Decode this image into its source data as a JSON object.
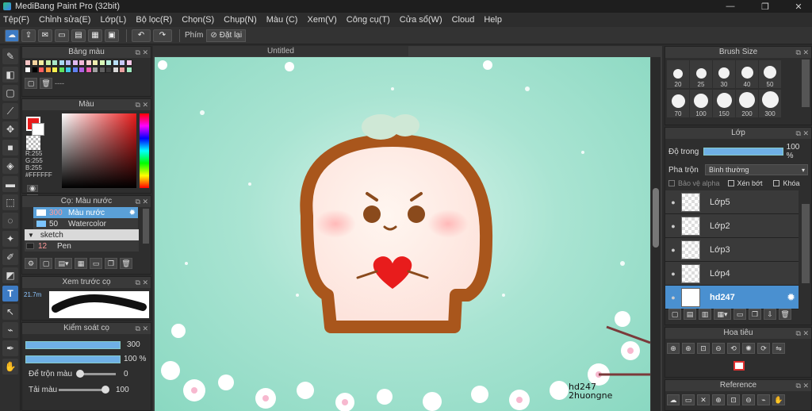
{
  "window": {
    "title": "MediBang Paint Pro (32bit)",
    "min": "—",
    "max": "❐",
    "close": "✕"
  },
  "menu": [
    "Tệp(F)",
    "Chỉnh sửa(E)",
    "Lớp(L)",
    "Bộ lọc(R)",
    "Chọn(S)",
    "Chụp(N)",
    "Màu (C)",
    "Xem(V)",
    "Công cụ(T)",
    "Cửa sổ(W)",
    "Cloud",
    "Help"
  ],
  "toolbar": {
    "shortcut_label": "Phím",
    "reset_label": "Đặt lại"
  },
  "palette": {
    "title": "Bảng màu",
    "footer": "----",
    "colors": [
      "#f7c6c6",
      "#f3d3a0",
      "#f4eea0",
      "#c8f0a8",
      "#a8e6c8",
      "#a8d8f0",
      "#b8b8f0",
      "#e0b8f0",
      "#f0b8d8",
      "#f8d0d0",
      "#f0f0b0",
      "#d8f8b8",
      "#b8f0e0",
      "#b8e0f8",
      "#c8c8f8",
      "#f8c8e8",
      "#ffffff",
      "#000000",
      "#ff6060",
      "#ffa040",
      "#f8f050",
      "#60e060",
      "#40c8e8",
      "#6080f0",
      "#b060e0",
      "#f060b0",
      "#a0a0a0",
      "#606060",
      "#404040",
      "#d8d8d8",
      "#e8a0a0",
      "#a0e8c0"
    ]
  },
  "color": {
    "title": "Màu",
    "r": "R:255",
    "g": "G:255",
    "b": "B:255",
    "hex": "#FFFFFF"
  },
  "brush": {
    "title": "Cọ: Màu nước",
    "items": [
      {
        "size": "300",
        "name": "Màu nước",
        "selected": true
      },
      {
        "size": "50",
        "name": "Watercolor",
        "selected": false
      },
      {
        "size": "",
        "name": "sketch",
        "group": true
      },
      {
        "size": "12",
        "name": "Pen",
        "selected": false
      }
    ]
  },
  "preview": {
    "title": "Xem trước cọ",
    "value": "21.7m"
  },
  "brushcontrol": {
    "title": "Kiểm soát cọ",
    "size_value": "300",
    "opacity_value": "100 %",
    "mix_label": "Để trộn màu",
    "mix_value": "0",
    "refill_label": "Tải màu",
    "refill_value": "100"
  },
  "canvas": {
    "tab": "Untitled",
    "signature_line1": "hd247",
    "signature_line2": "2huongne"
  },
  "brushsize": {
    "title": "Brush Size",
    "sizes": [
      "20",
      "25",
      "30",
      "40",
      "50",
      "70",
      "100",
      "150",
      "200",
      "300"
    ]
  },
  "layer": {
    "title": "Lớp",
    "opacity_label": "Độ trong",
    "opacity_value": "100 %",
    "blend_label": "Pha trộn",
    "blend_value": "Bình thường",
    "protect_alpha": "Bảo vệ alpha",
    "clip": "Xén bớt",
    "lock": "Khóa",
    "layers": [
      {
        "name": "Lớp5",
        "selected": false
      },
      {
        "name": "Lớp2",
        "selected": false
      },
      {
        "name": "Lớp3",
        "selected": false
      },
      {
        "name": "Lớp4",
        "selected": false
      },
      {
        "name": "hd247",
        "selected": true
      }
    ]
  },
  "navigator": {
    "title": "Hoa tiêu"
  },
  "reference": {
    "title": "Reference"
  },
  "colors": {
    "accent": "#5aa0d8",
    "panel": "#2e2e2e",
    "heart": "#e81c1c",
    "outline": "#a9561c"
  }
}
